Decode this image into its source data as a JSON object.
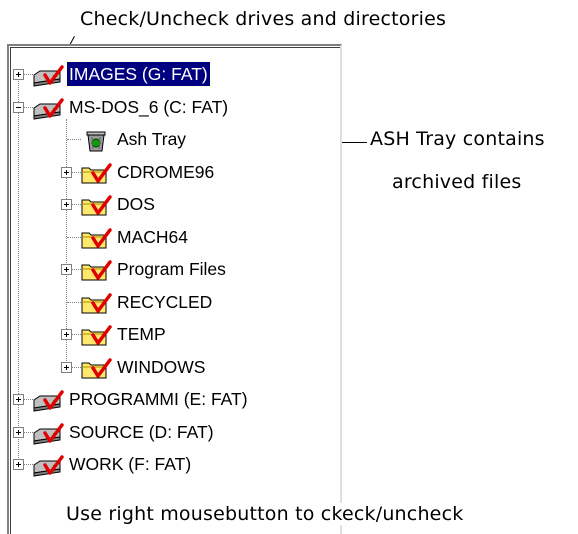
{
  "annotations": {
    "top": "Check/Uncheck drives and directories",
    "ash_line1": "ASH Tray contains",
    "ash_line2": "archived files",
    "bottom": "Use right mousebutton to ckeck/uncheck"
  },
  "tree": {
    "items": [
      {
        "label": "IMAGES (G: FAT)",
        "type": "drive",
        "selected": true,
        "expander": "plus"
      },
      {
        "label": "MS-DOS_6 (C: FAT)",
        "type": "drive",
        "expander": "minus"
      },
      {
        "label": "Ash Tray",
        "type": "ashtray"
      },
      {
        "label": "CDROME96",
        "type": "folder",
        "expander": "plus"
      },
      {
        "label": "DOS",
        "type": "folder",
        "expander": "plus"
      },
      {
        "label": "MACH64",
        "type": "folder"
      },
      {
        "label": "Program Files",
        "type": "folder",
        "expander": "plus"
      },
      {
        "label": "RECYCLED",
        "type": "folder"
      },
      {
        "label": "TEMP",
        "type": "folder",
        "expander": "plus"
      },
      {
        "label": "WINDOWS",
        "type": "folder",
        "expander": "plus"
      },
      {
        "label": "PROGRAMMI (E: FAT)",
        "type": "drive",
        "expander": "plus"
      },
      {
        "label": "SOURCE (D: FAT)",
        "type": "drive",
        "expander": "plus"
      },
      {
        "label": "WORK (F: FAT)",
        "type": "drive",
        "expander": "plus"
      }
    ]
  },
  "colors": {
    "selection": "#000080",
    "check": "#e00000",
    "folder": "#ffe86b",
    "drive": "#c0c0c0"
  }
}
